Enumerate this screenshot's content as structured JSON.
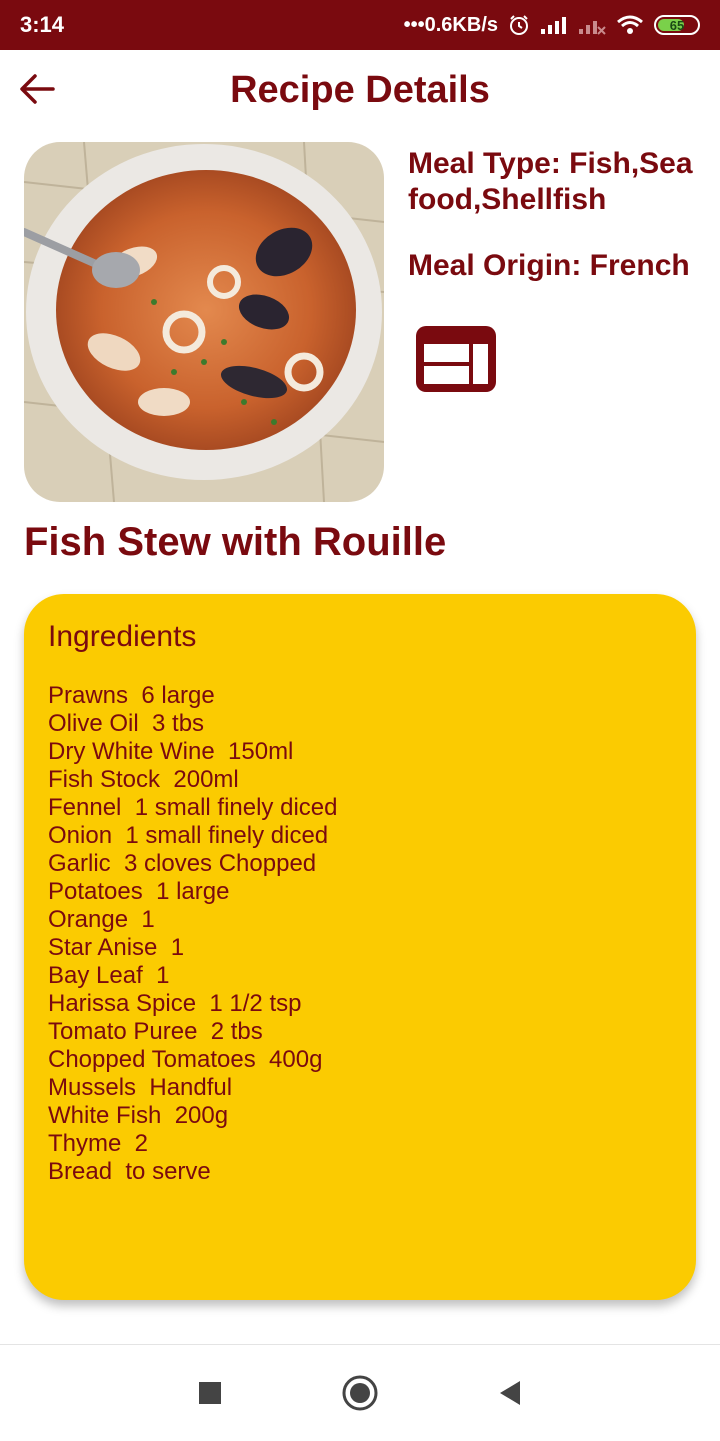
{
  "status_bar": {
    "time": "3:14",
    "speed": "•••0.6KB/s",
    "battery": "65"
  },
  "header": {
    "title": "Recipe Details",
    "back_icon": "arrow-left-icon"
  },
  "recipe": {
    "image_alt": "fish-stew-photo",
    "meal_type": "Meal Type: Fish,Sea food,Shellfish",
    "meal_origin": "Meal Origin: French",
    "layout_icon": "web-layout-icon",
    "name": "Fish Stew with Rouille"
  },
  "ingredients": {
    "heading": "Ingredients",
    "items": [
      "Prawns  6 large",
      "Olive Oil  3 tbs",
      "Dry White Wine  150ml",
      "Fish Stock  200ml",
      "Fennel  1 small finely diced",
      "Onion  1 small finely diced",
      "Garlic  3 cloves Chopped",
      "Potatoes  1 large",
      "Orange  1",
      "Star Anise  1",
      "Bay Leaf  1",
      "Harissa Spice  1 1/2 tsp",
      "Tomato Puree  2 tbs",
      "Chopped Tomatoes  400g",
      "Mussels  Handful",
      "White Fish  200g",
      "Thyme  2",
      "Bread  to serve"
    ]
  },
  "nav_bar": {
    "recents_icon": "square-recents-icon",
    "home_icon": "circle-home-icon",
    "back_icon": "triangle-back-icon"
  },
  "colors": {
    "primary": "#7a0a0f",
    "card": "#fbcb01",
    "background": "#ffffff"
  }
}
